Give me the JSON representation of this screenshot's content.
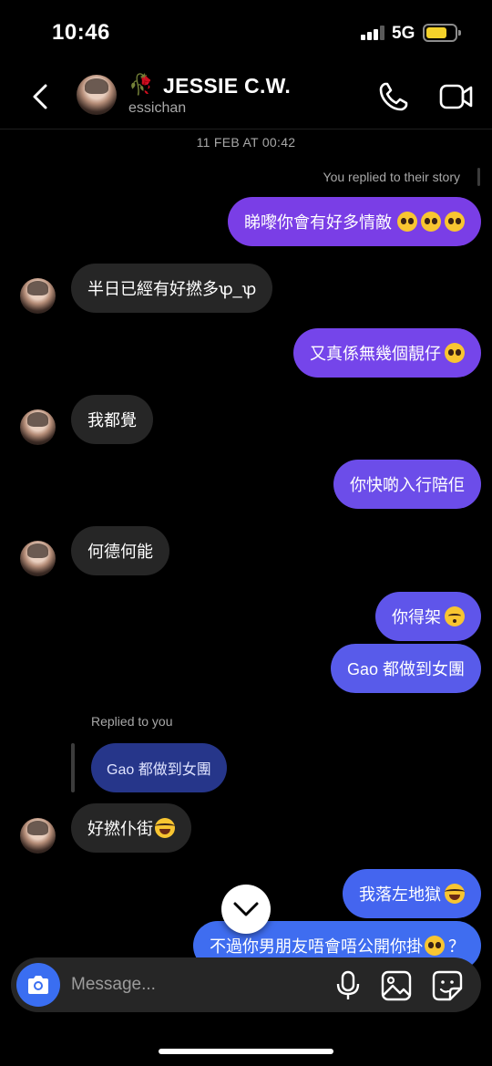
{
  "status_bar": {
    "time": "10:46",
    "network": "5G"
  },
  "header": {
    "contact_name": "JESSIE C.W.",
    "username": "essichan",
    "name_prefix_icon": "rose-icon",
    "actions": [
      "phone-icon",
      "video-icon"
    ]
  },
  "thread": {
    "date": "11 FEB AT 00:42",
    "story_reply_note": "You replied to their story",
    "replied_to_you_note": "Replied to you",
    "messages": [
      {
        "from": "me",
        "text": "睇嚟你會有好多情敵",
        "emoji": [
          "pleading",
          "pleading",
          "pleading"
        ]
      },
      {
        "from": "them",
        "text": "半日已經有好撚多ꝕ_ꝕ"
      },
      {
        "from": "me",
        "text": "又真係無幾個靚仔",
        "emoji": [
          "pleading"
        ]
      },
      {
        "from": "them",
        "text": "我都覺"
      },
      {
        "from": "me",
        "text": "你快啲入行陪佢"
      },
      {
        "from": "them",
        "text": "何德何能"
      },
      {
        "from": "me",
        "text": "你得架",
        "emoji": [
          "kissing"
        ]
      },
      {
        "from": "me",
        "text": "Gao 都做到女團"
      },
      {
        "from": "them",
        "quoted": "Gao 都做到女團",
        "text": "好撚仆街",
        "emoji": [
          "laughing"
        ]
      },
      {
        "from": "me",
        "text": "我落左地獄",
        "emoji": [
          "laughing"
        ]
      },
      {
        "from": "me",
        "text": "不過你男朋友唔會唔公開你掛",
        "emoji": [
          "pleading"
        ],
        "suffix": "？"
      }
    ]
  },
  "composer": {
    "placeholder": "Message...",
    "icons": [
      "camera-icon",
      "microphone-icon",
      "gallery-icon",
      "sticker-icon"
    ]
  },
  "colors": {
    "background": "#000000",
    "incoming_bubble": "#262626",
    "outgoing_purple": "#7a3ee6",
    "outgoing_blue": "#3f6df0",
    "quoted_bubble": "#26368a",
    "camera_button": "#3a6ef1"
  }
}
